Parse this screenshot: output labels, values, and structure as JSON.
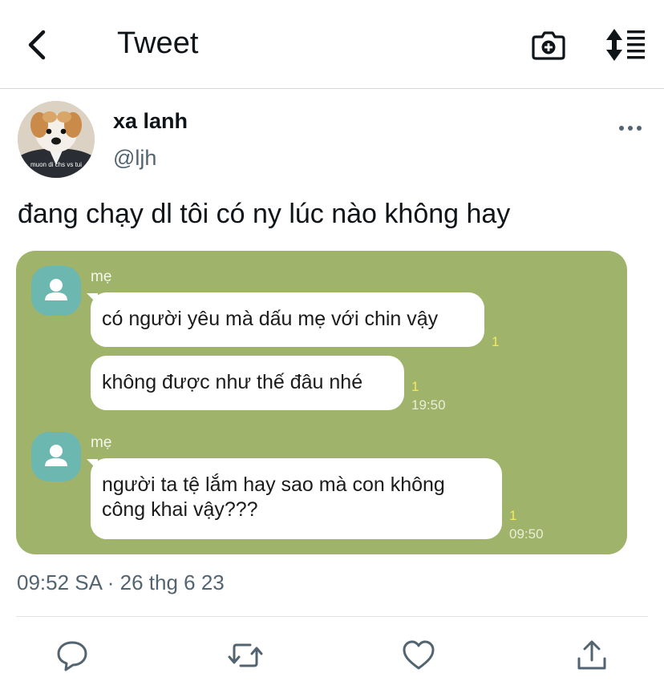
{
  "header": {
    "title": "Tweet",
    "back_icon": "chevron-left-icon",
    "camera_icon": "camera-plus-icon",
    "sort_icon": "sort-list-icon"
  },
  "author": {
    "name": "xa lanh",
    "handle": "@ljh",
    "avatar_caption": "muon di chs vs tui"
  },
  "tweet": {
    "text": "đang chạy dl tôi có ny lúc nào không hay",
    "timestamp": "09:52 SA · 26 thg 6 23"
  },
  "chat": {
    "background": "#9fb46a",
    "groups": [
      {
        "sender": "mẹ",
        "messages": [
          {
            "text": "có người yêu mà dấu mẹ với chin vậy",
            "read": "1",
            "time": ""
          },
          {
            "text": "không được như thế đâu nhé",
            "read": "1",
            "time": "19:50"
          }
        ]
      },
      {
        "sender": "mẹ",
        "messages": [
          {
            "text": "người ta tệ lắm hay sao mà con không công khai vậy???",
            "read": "1",
            "time": "09:50"
          }
        ]
      }
    ]
  },
  "actions": [
    "reply-icon",
    "retweet-icon",
    "like-icon",
    "share-icon"
  ]
}
